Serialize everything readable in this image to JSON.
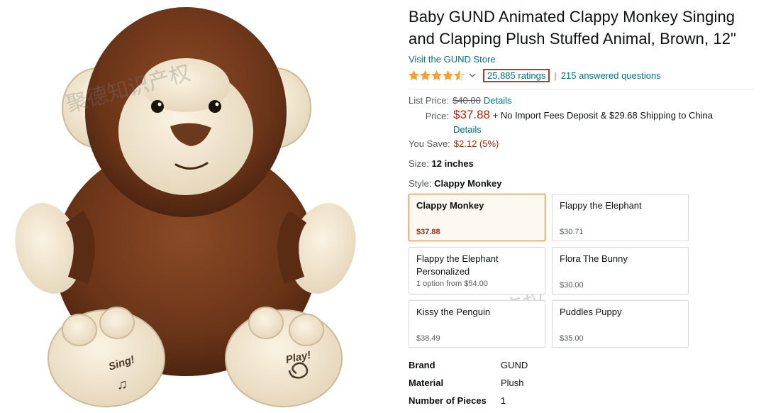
{
  "product": {
    "title": "Baby GUND Animated Clappy Monkey Singing and Clapping Plush Stuffed Animal, Brown, 12\"",
    "store_link": "Visit the GUND Store",
    "rating": 4.5,
    "ratings_count": "25,885 ratings",
    "separator": "|",
    "answered_questions": "215 answered questions",
    "image_labels": {
      "left_foot": "Sing!",
      "right_foot": "Play!"
    }
  },
  "pricing": {
    "list_price_label": "List Price:",
    "list_price": "$40.00",
    "list_price_details": "Details",
    "price_label": "Price:",
    "price": "$37.88",
    "shipping": "+ No Import Fees Deposit & $29.68 Shipping to China",
    "price_details": "Details",
    "you_save_label": "You Save:",
    "you_save": "$2.12 (5%)"
  },
  "size": {
    "label": "Size:",
    "value": "12 inches"
  },
  "style": {
    "label": "Style:",
    "value": "Clappy Monkey",
    "options": [
      {
        "name": "Clappy Monkey",
        "sub": "",
        "price": "$37.88",
        "selected": true
      },
      {
        "name": "Flappy the Elephant",
        "sub": "",
        "price": "$30.71",
        "selected": false
      },
      {
        "name": "Flappy the Elephant Personalized",
        "sub": "1 option from $54.00",
        "price": "",
        "selected": false
      },
      {
        "name": "Flora The Bunny",
        "sub": "",
        "price": "$30.00",
        "selected": false
      },
      {
        "name": "Kissy the Penguin",
        "sub": "",
        "price": "$38.49",
        "selected": false
      },
      {
        "name": "Puddles Puppy",
        "sub": "",
        "price": "$35.00",
        "selected": false
      }
    ]
  },
  "specs": [
    {
      "key": "Brand",
      "value": "GUND"
    },
    {
      "key": "Material",
      "value": "Plush"
    },
    {
      "key": "Number of Pieces",
      "value": "1"
    }
  ],
  "watermark": "聚德知识产权",
  "colors": {
    "link": "#007185",
    "price": "#b12704",
    "star": "#ffa41c",
    "selected_border": "#e77600",
    "highlight_box": "#c9302c"
  }
}
